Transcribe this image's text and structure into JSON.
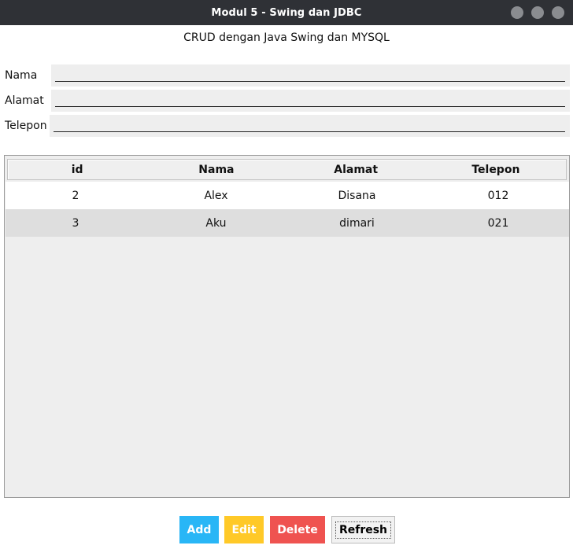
{
  "window": {
    "title": "Modul 5 - Swing dan JDBC",
    "controls": [
      "minimize",
      "maximize",
      "close"
    ]
  },
  "header": {
    "subtitle": "CRUD dengan Java Swing dan MYSQL"
  },
  "form": {
    "fields": [
      {
        "label": "Nama",
        "value": ""
      },
      {
        "label": "Alamat",
        "value": ""
      },
      {
        "label": "Telepon",
        "value": ""
      }
    ]
  },
  "table": {
    "columns": [
      "id",
      "Nama",
      "Alamat",
      "Telepon"
    ],
    "rows": [
      [
        "2",
        "Alex",
        "Disana",
        "012"
      ],
      [
        "3",
        "Aku",
        "dimari",
        "021"
      ]
    ]
  },
  "buttons": {
    "add": "Add",
    "edit": "Edit",
    "delete": "Delete",
    "refresh": "Refresh"
  },
  "colors": {
    "titlebar": "#2f3136",
    "add": "#29b6f6",
    "edit": "#ffc928",
    "delete": "#ef5350"
  }
}
